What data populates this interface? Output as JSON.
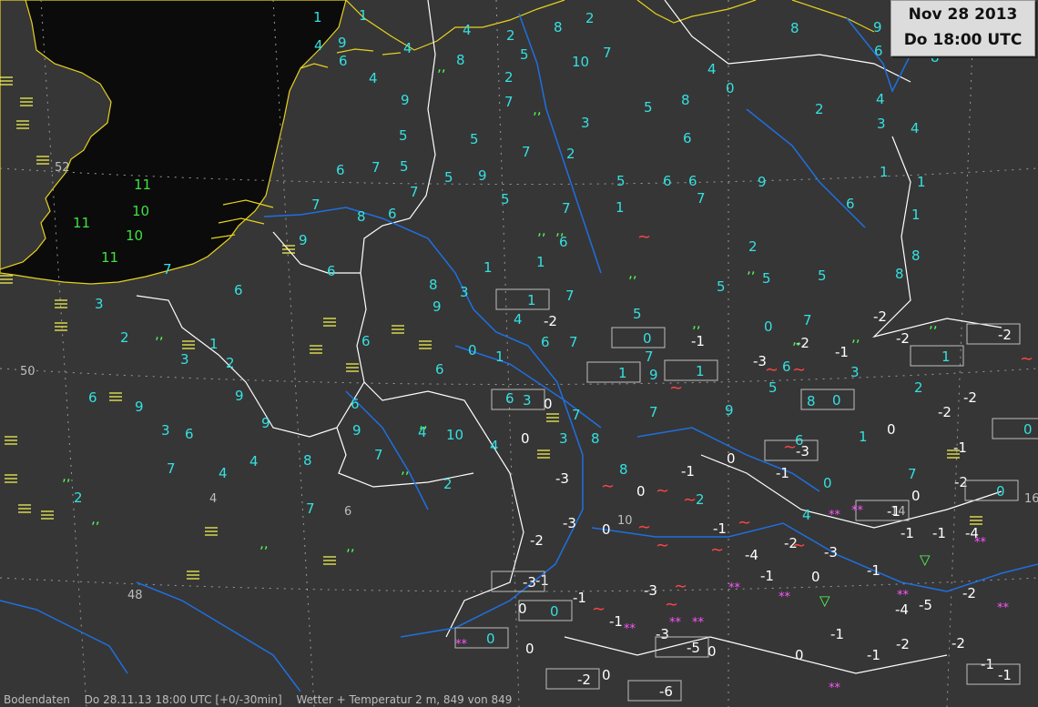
{
  "header": {
    "date": "Nov 28 2013",
    "time": "Do 18:00 UTC"
  },
  "status": {
    "source": "Bodendaten",
    "datetime": "Do 28.11.13 18:00 UTC [+0/-30min]",
    "product": "Wetter + Temperatur 2 m, 849 von 849"
  },
  "colors": {
    "sea": "#0b0b0b",
    "land": "#363636",
    "coast": "#e6d21e",
    "border": "#ffffff",
    "river": "#1f6fe0",
    "grid": "#9a9a9a",
    "warm": "#3fe13f",
    "mild": "#35e0e0",
    "cold": "#ffffff",
    "fog": "#ffff55",
    "drizzle": "#55ff55",
    "snow": "#ff55ff",
    "precip": "#ff4444"
  },
  "grid_labels": [
    {
      "text": "52"
    },
    {
      "text": "50"
    },
    {
      "text": "48"
    },
    {
      "text": "4"
    },
    {
      "text": "6"
    },
    {
      "text": "10"
    },
    {
      "text": "14"
    },
    {
      "text": "16"
    }
  ],
  "stations": [
    {
      "t": "8",
      "c": "mild"
    },
    {
      "t": "10",
      "c": "mild"
    },
    {
      "t": "9",
      "c": "mild"
    },
    {
      "t": "9",
      "c": "mild"
    },
    {
      "t": "9",
      "c": "mild"
    },
    {
      "t": "8",
      "c": "mild"
    },
    {
      "t": "8",
      "c": "mild"
    },
    {
      "t": "9",
      "c": "mild"
    },
    {
      "t": "9",
      "c": "mild"
    },
    {
      "t": "9",
      "c": "mild"
    },
    {
      "t": "9",
      "c": "mild"
    },
    {
      "t": "6",
      "c": "mild"
    },
    {
      "t": "8",
      "c": "mild"
    },
    {
      "t": "7",
      "c": "mild"
    },
    {
      "t": "7",
      "c": "mild"
    },
    {
      "t": "8",
      "c": "mild"
    },
    {
      "t": "8",
      "c": "mild"
    },
    {
      "t": "11",
      "c": "warm"
    },
    {
      "t": "10",
      "c": "warm"
    },
    {
      "t": "10",
      "c": "warm"
    },
    {
      "t": "9",
      "c": "mild"
    },
    {
      "t": "8",
      "c": "mild"
    },
    {
      "t": "11",
      "c": "warm"
    },
    {
      "t": "11",
      "c": "warm"
    },
    {
      "t": "9",
      "c": "mild"
    },
    {
      "t": "9",
      "c": "mild"
    },
    {
      "t": "9",
      "c": "mild"
    },
    {
      "t": "8",
      "c": "mild"
    },
    {
      "t": "9",
      "c": "mild"
    },
    {
      "t": "9",
      "c": "mild"
    },
    {
      "t": "10",
      "c": "mild"
    },
    {
      "t": "8",
      "c": "mild"
    },
    {
      "t": "7",
      "c": "mild"
    },
    {
      "t": "8",
      "c": "mild"
    },
    {
      "t": "7",
      "c": "mild"
    },
    {
      "t": "8",
      "c": "mild"
    },
    {
      "t": "6",
      "c": "mild"
    },
    {
      "t": "8",
      "c": "mild"
    },
    {
      "t": "8",
      "c": "mild"
    },
    {
      "t": "7",
      "c": "mild"
    },
    {
      "t": "7",
      "c": "mild"
    },
    {
      "t": "6",
      "c": "mild"
    },
    {
      "t": "6",
      "c": "mild"
    },
    {
      "t": "7",
      "c": "mild"
    },
    {
      "t": "6",
      "c": "mild"
    },
    {
      "t": "6",
      "c": "mild"
    },
    {
      "t": "7",
      "c": "mild"
    },
    {
      "t": "7",
      "c": "mild"
    },
    {
      "t": "6",
      "c": "mild"
    },
    {
      "t": "6",
      "c": "mild"
    },
    {
      "t": "7",
      "c": "mild"
    },
    {
      "t": "6",
      "c": "mild"
    },
    {
      "t": "7",
      "c": "mild"
    },
    {
      "t": "7",
      "c": "mild"
    },
    {
      "t": "6",
      "c": "mild"
    },
    {
      "t": "7",
      "c": "mild"
    },
    {
      "t": "6",
      "c": "mild"
    },
    {
      "t": "7",
      "c": "mild"
    },
    {
      "t": "7",
      "c": "mild"
    },
    {
      "t": "7",
      "c": "mild"
    },
    {
      "t": "7",
      "c": "mild"
    },
    {
      "t": "6",
      "c": "mild"
    },
    {
      "t": "6",
      "c": "mild"
    },
    {
      "t": "5",
      "c": "mild"
    },
    {
      "t": "6",
      "c": "mild"
    },
    {
      "t": "7",
      "c": "mild"
    },
    {
      "t": "7",
      "c": "mild"
    },
    {
      "t": "6",
      "c": "mild"
    },
    {
      "t": "5",
      "c": "mild"
    },
    {
      "t": "6",
      "c": "mild"
    },
    {
      "t": "5",
      "c": "mild"
    },
    {
      "t": "4",
      "c": "mild"
    },
    {
      "t": "5",
      "c": "mild"
    },
    {
      "t": "6",
      "c": "mild"
    },
    {
      "t": "5",
      "c": "mild"
    },
    {
      "t": "4",
      "c": "mild"
    },
    {
      "t": "5",
      "c": "mild"
    },
    {
      "t": "4",
      "c": "mild"
    },
    {
      "t": "5",
      "c": "mild"
    },
    {
      "t": "4",
      "c": "mild"
    },
    {
      "t": "4",
      "c": "mild"
    },
    {
      "t": "3",
      "c": "mild"
    },
    {
      "t": "2",
      "c": "mild"
    },
    {
      "t": "2",
      "c": "mild"
    },
    {
      "t": "1",
      "c": "mild"
    },
    {
      "t": "2",
      "c": "mild"
    },
    {
      "t": "3",
      "c": "mild"
    },
    {
      "t": "4",
      "c": "mild"
    },
    {
      "t": "2",
      "c": "mild"
    },
    {
      "t": "1",
      "c": "mild"
    },
    {
      "t": "0",
      "c": "cold"
    },
    {
      "t": "2",
      "c": "mild"
    },
    {
      "t": "1",
      "c": "mild"
    },
    {
      "t": "0",
      "c": "mild"
    },
    {
      "t": "1",
      "c": "mild"
    },
    {
      "t": "0",
      "c": "cold"
    },
    {
      "t": "1",
      "c": "mild"
    },
    {
      "t": "0",
      "c": "cold"
    },
    {
      "t": "0",
      "c": "cold"
    },
    {
      "t": "-1",
      "c": "cold"
    },
    {
      "t": "0",
      "c": "cold"
    },
    {
      "t": "-2",
      "c": "cold"
    },
    {
      "t": "-1",
      "c": "cold"
    },
    {
      "t": "0",
      "c": "cold"
    },
    {
      "t": "-1",
      "c": "cold"
    },
    {
      "t": "-1",
      "c": "cold"
    },
    {
      "t": "-3",
      "c": "cold"
    },
    {
      "t": "-2",
      "c": "cold"
    },
    {
      "t": "0",
      "c": "cold"
    },
    {
      "t": "-1",
      "c": "cold"
    },
    {
      "t": "1",
      "c": "mild"
    },
    {
      "t": "2",
      "c": "mild"
    },
    {
      "t": "3",
      "c": "mild"
    },
    {
      "t": "1",
      "c": "mild"
    },
    {
      "t": "0",
      "c": "cold"
    },
    {
      "t": "-1",
      "c": "cold"
    },
    {
      "t": "0",
      "c": "cold"
    },
    {
      "t": "1",
      "c": "mild"
    },
    {
      "t": "-1",
      "c": "cold"
    },
    {
      "t": "0",
      "c": "cold"
    },
    {
      "t": "-2",
      "c": "cold"
    },
    {
      "t": "-1",
      "c": "cold"
    },
    {
      "t": "-2",
      "c": "cold"
    },
    {
      "t": "-1",
      "c": "cold"
    },
    {
      "t": "-3",
      "c": "cold"
    },
    {
      "t": "-2",
      "c": "cold"
    },
    {
      "t": "-4",
      "c": "cold"
    },
    {
      "t": "-3",
      "c": "cold"
    },
    {
      "t": "-2",
      "c": "cold"
    },
    {
      "t": "-1",
      "c": "cold"
    },
    {
      "t": "-2",
      "c": "cold"
    },
    {
      "t": "-2",
      "c": "cold"
    },
    {
      "t": "-3",
      "c": "cold"
    },
    {
      "t": "-1",
      "c": "cold"
    },
    {
      "t": "-2",
      "c": "cold"
    },
    {
      "t": "-5",
      "c": "cold"
    },
    {
      "t": "-4",
      "c": "cold"
    },
    {
      "t": "-3",
      "c": "cold"
    },
    {
      "t": "-2",
      "c": "cold"
    },
    {
      "t": "-1",
      "c": "cold"
    },
    {
      "t": "0",
      "c": "cold"
    },
    {
      "t": "-1",
      "c": "cold"
    },
    {
      "t": "-2",
      "c": "cold"
    },
    {
      "t": "-1",
      "c": "cold"
    },
    {
      "t": "0",
      "c": "cold"
    },
    {
      "t": "4",
      "c": "mild"
    },
    {
      "t": "5",
      "c": "mild"
    },
    {
      "t": "6",
      "c": "mild"
    },
    {
      "t": "5",
      "c": "mild"
    },
    {
      "t": "3",
      "c": "mild"
    },
    {
      "t": "2",
      "c": "mild"
    },
    {
      "t": "3",
      "c": "mild"
    },
    {
      "t": "2",
      "c": "mild"
    },
    {
      "t": "0",
      "c": "mild"
    },
    {
      "t": "4",
      "c": "mild"
    },
    {
      "t": "5",
      "c": "mild"
    },
    {
      "t": "0",
      "c": "cold"
    },
    {
      "t": "1",
      "c": "mild"
    },
    {
      "t": "2",
      "c": "mild"
    },
    {
      "t": "1",
      "c": "mild"
    },
    {
      "t": "-1",
      "c": "cold"
    },
    {
      "t": "-3",
      "c": "cold"
    },
    {
      "t": "-2",
      "c": "cold"
    },
    {
      "t": "-1",
      "c": "cold"
    },
    {
      "t": "-4",
      "c": "cold"
    },
    {
      "t": "3",
      "c": "mild"
    },
    {
      "t": "2",
      "c": "mild"
    },
    {
      "t": "5",
      "c": "mild"
    },
    {
      "t": "4",
      "c": "mild"
    },
    {
      "t": "2",
      "c": "mild"
    },
    {
      "t": "1",
      "c": "mild"
    },
    {
      "t": "0",
      "c": "mild"
    },
    {
      "t": "6",
      "c": "mild"
    },
    {
      "t": "5",
      "c": "mild"
    },
    {
      "t": "3",
      "c": "mild"
    },
    {
      "t": "4",
      "c": "mild"
    },
    {
      "t": "2",
      "c": "mild"
    },
    {
      "t": "3",
      "c": "mild"
    },
    {
      "t": "5",
      "c": "mild"
    },
    {
      "t": "4",
      "c": "mild"
    },
    {
      "t": "0",
      "c": "mild"
    },
    {
      "t": "4",
      "c": "mild"
    },
    {
      "t": "6",
      "c": "mild"
    },
    {
      "t": "4",
      "c": "mild"
    },
    {
      "t": "5",
      "c": "mild"
    }
  ],
  "boxed": [
    {
      "t": "1"
    },
    {
      "t": "3"
    },
    {
      "t": "0"
    },
    {
      "t": "1"
    },
    {
      "t": "0"
    },
    {
      "t": "-2"
    },
    {
      "t": "0"
    },
    {
      "t": "-3"
    },
    {
      "t": "0"
    },
    {
      "t": "-3"
    },
    {
      "t": "-1"
    },
    {
      "t": "0"
    },
    {
      "t": "-1"
    },
    {
      "t": "-5"
    },
    {
      "t": "-2"
    },
    {
      "t": "-6"
    },
    {
      "t": "0"
    },
    {
      "t": "1"
    },
    {
      "t": "1"
    }
  ]
}
